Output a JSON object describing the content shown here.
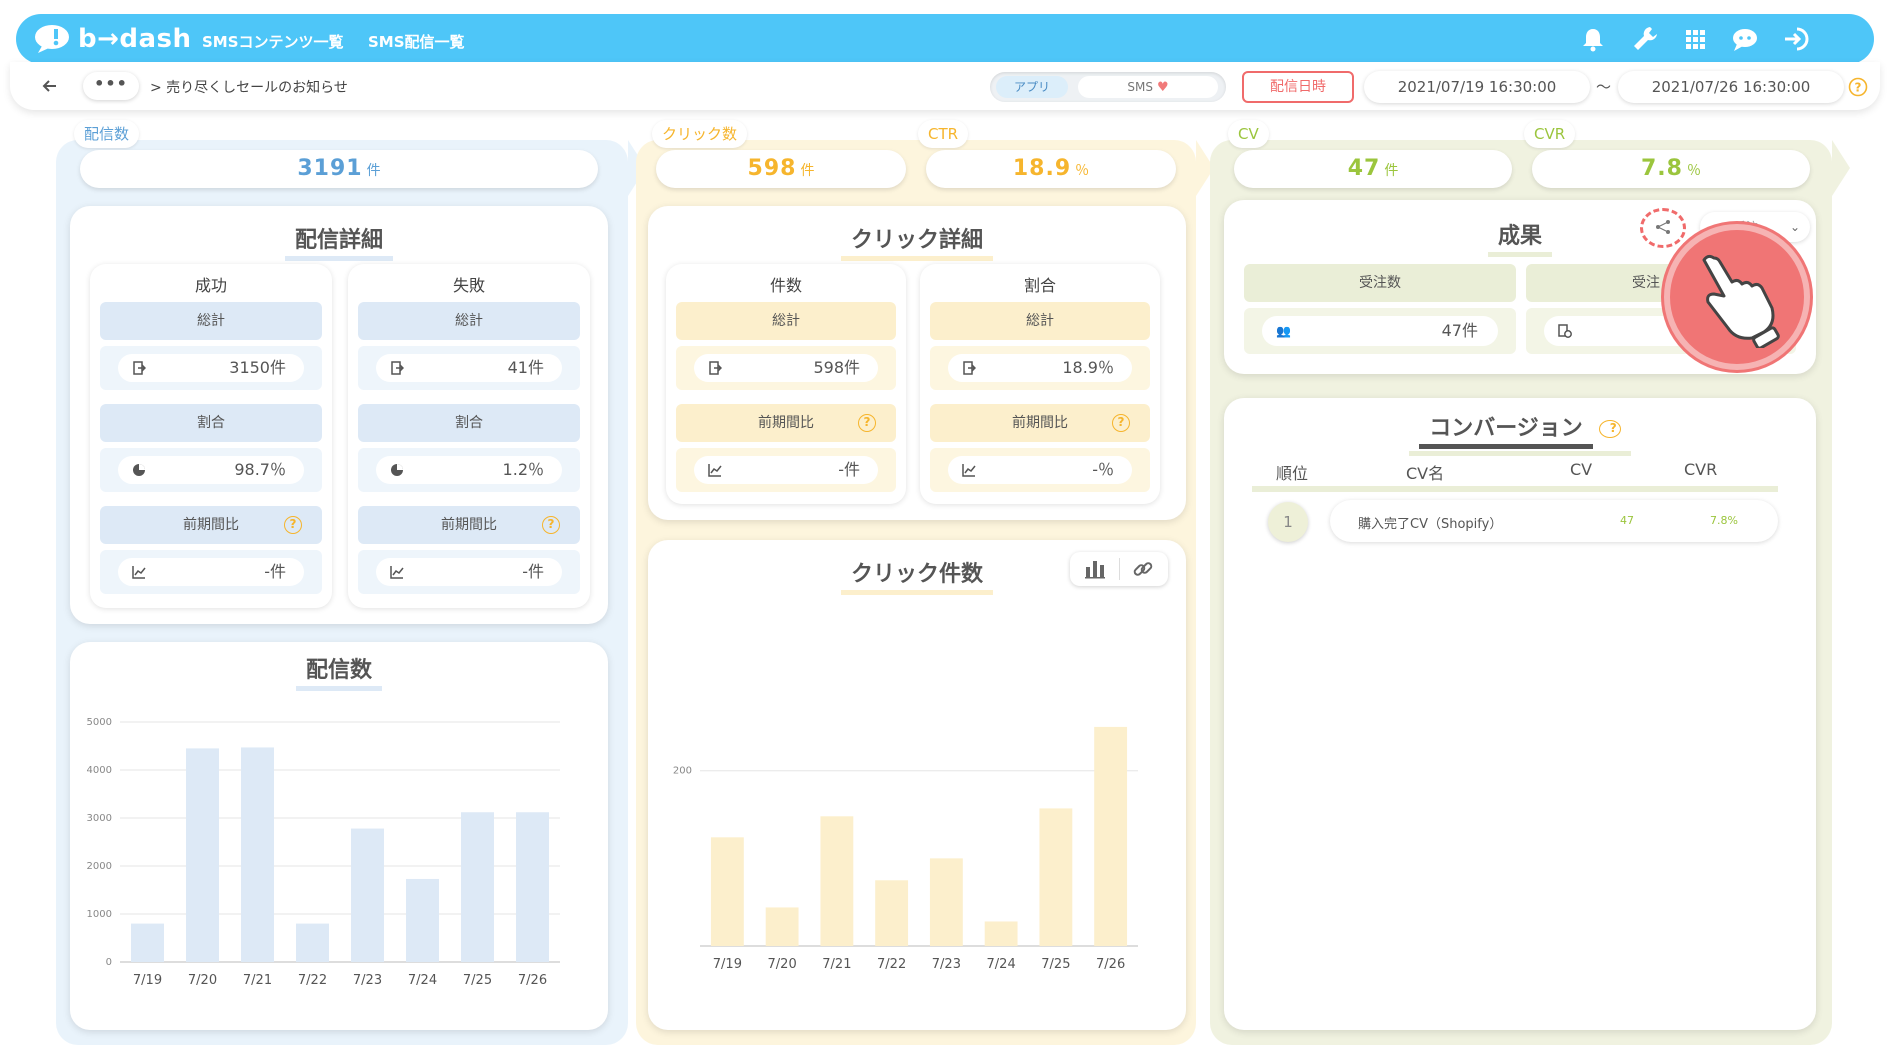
{
  "app": {
    "logo_text": "b→dash",
    "nav": [
      "SMSコンテンツ一覧",
      "SMS配信一覧"
    ],
    "icons": [
      "bell-icon",
      "wrench-icon",
      "grid-icon",
      "chat-icon",
      "logout-icon"
    ]
  },
  "breadcrumb": {
    "more": "•••",
    "path": "> 売り尽くしセールのお知らせ",
    "toggle_app": "アプリ",
    "toggle_sms": "SMS",
    "date_button": "配信日時",
    "date_from": "2021/07/19 16:30:00",
    "tilde": "〜",
    "date_to": "2021/07/26 16:30:00"
  },
  "colors": {
    "topbar": "#4ec6f8",
    "blue": "#5b9fd6",
    "yellow": "#f6b52d",
    "green": "#9bc53d",
    "date_red": "#f06b6b"
  },
  "delivery": {
    "tag": "配信数",
    "count": "3191",
    "unit": "件",
    "detail_title": "配信詳細",
    "success": {
      "title": "成功",
      "total_label": "総計",
      "total": "3150件",
      "ratio_label": "割合",
      "ratio": "98.7％",
      "prev_label": "前期間比",
      "prev": "-件"
    },
    "failure": {
      "title": "失敗",
      "total_label": "総計",
      "total": "41件",
      "ratio_label": "割合",
      "ratio": "1.2％",
      "prev_label": "前期間比",
      "prev": "-件"
    },
    "chart_title": "配信数"
  },
  "click": {
    "tag": "クリック数",
    "count": "598",
    "unit": "件",
    "ctr_tag": "CTR",
    "ctr": "18.9",
    "ctr_unit": "％",
    "detail_title": "クリック詳細",
    "count_block": {
      "title": "件数",
      "total_label": "総計",
      "total": "598件",
      "prev_label": "前期間比",
      "prev": "-件"
    },
    "ratio_block": {
      "title": "割合",
      "total_label": "総計",
      "total": "18.9％",
      "prev_label": "前期間比",
      "prev": "-％"
    },
    "chart_title": "クリック件数"
  },
  "conversion": {
    "cv_tag": "CV",
    "cv": "47",
    "cv_unit": "件",
    "cvr_tag": "CVR",
    "cvr": "7.8",
    "cvr_unit": "％",
    "result_title": "成果",
    "result_select": "受注",
    "orders_label": "受注数",
    "orders_value": "47件",
    "second_label": "受注",
    "table_title": "コンバージョン",
    "table_headers": [
      "順位",
      "CV名",
      "CV",
      "CVR"
    ],
    "rows": [
      {
        "rank": "1",
        "name": "購入完了CV（Shopify）",
        "cv": "47",
        "cvr": "7.8%"
      }
    ]
  },
  "chart_data": [
    {
      "type": "bar",
      "title": "配信数",
      "categories": [
        "7/19",
        "7/20",
        "7/21",
        "7/22",
        "7/23",
        "7/24",
        "7/25",
        "7/26"
      ],
      "values": [
        800,
        4450,
        4470,
        800,
        2780,
        1730,
        3120,
        3120
      ],
      "yticks": [
        "5000",
        "4000",
        "3000",
        "2000",
        "1000",
        "0"
      ],
      "ylim": [
        0,
        5000
      ],
      "color": "#dde9f6"
    },
    {
      "type": "bar",
      "title": "クリック件数",
      "categories": [
        "7/19",
        "7/20",
        "7/21",
        "7/22",
        "7/23",
        "7/24",
        "7/25",
        "7/26"
      ],
      "values": [
        124,
        44,
        148,
        75,
        100,
        28,
        157,
        250
      ],
      "yticks": [
        "200"
      ],
      "ylim": [
        0,
        267
      ],
      "color": "#fcefcc"
    }
  ]
}
